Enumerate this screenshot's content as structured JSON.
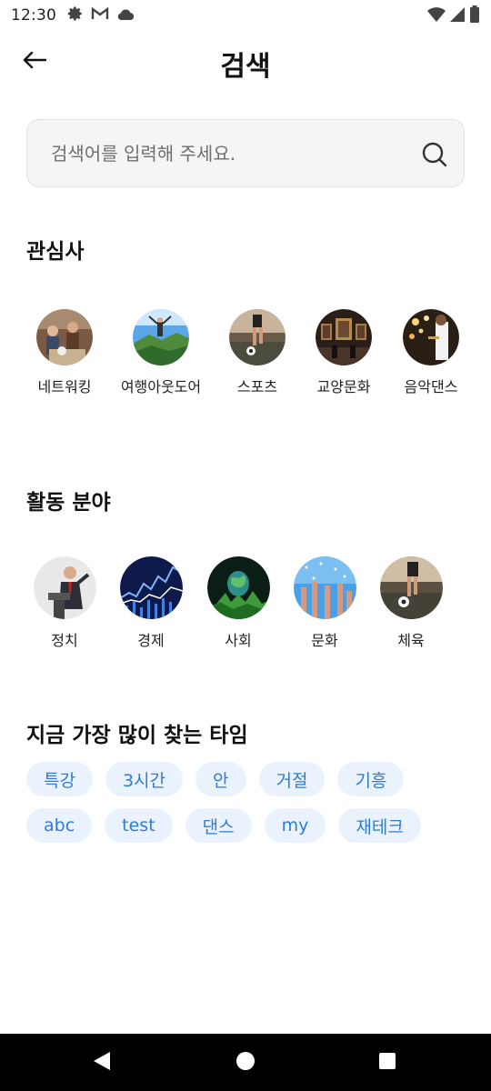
{
  "status_bar": {
    "time": "12:30",
    "icons_left": [
      "settings-icon",
      "gmail-icon",
      "cloud-icon"
    ],
    "icons_right": [
      "wifi-icon",
      "signal-icon",
      "battery-icon"
    ]
  },
  "header": {
    "title": "검색",
    "back_icon": "arrow-left-icon"
  },
  "search": {
    "placeholder": "검색어를 입력해 주세요.",
    "value": "",
    "icon": "search-icon"
  },
  "interests": {
    "title": "관심사",
    "items": [
      {
        "label": "네트워킹",
        "icon": "networking-photo"
      },
      {
        "label": "여행아웃도어",
        "icon": "travel-outdoor-photo"
      },
      {
        "label": "스포츠",
        "icon": "sports-photo"
      },
      {
        "label": "교양문화",
        "icon": "culture-photo"
      },
      {
        "label": "음악댄스",
        "icon": "music-dance-photo"
      }
    ]
  },
  "activities": {
    "title": "활동 분야",
    "items": [
      {
        "label": "정치",
        "icon": "politics-photo"
      },
      {
        "label": "경제",
        "icon": "economy-photo"
      },
      {
        "label": "사회",
        "icon": "society-photo"
      },
      {
        "label": "문화",
        "icon": "culture-crowd-photo"
      },
      {
        "label": "체육",
        "icon": "physical-education-photo"
      }
    ]
  },
  "popular": {
    "title": "지금 가장 많이 찾는 타임",
    "tags_row1": [
      "특강",
      "3시간",
      "안",
      "거절",
      "기흥"
    ],
    "tags_row2": [
      "abc",
      "test",
      "댄스",
      "my",
      "재테크"
    ]
  },
  "colors": {
    "tag_bg": "#eaf3fd",
    "tag_text": "#2f7bd9",
    "nav_bg": "#000000"
  }
}
